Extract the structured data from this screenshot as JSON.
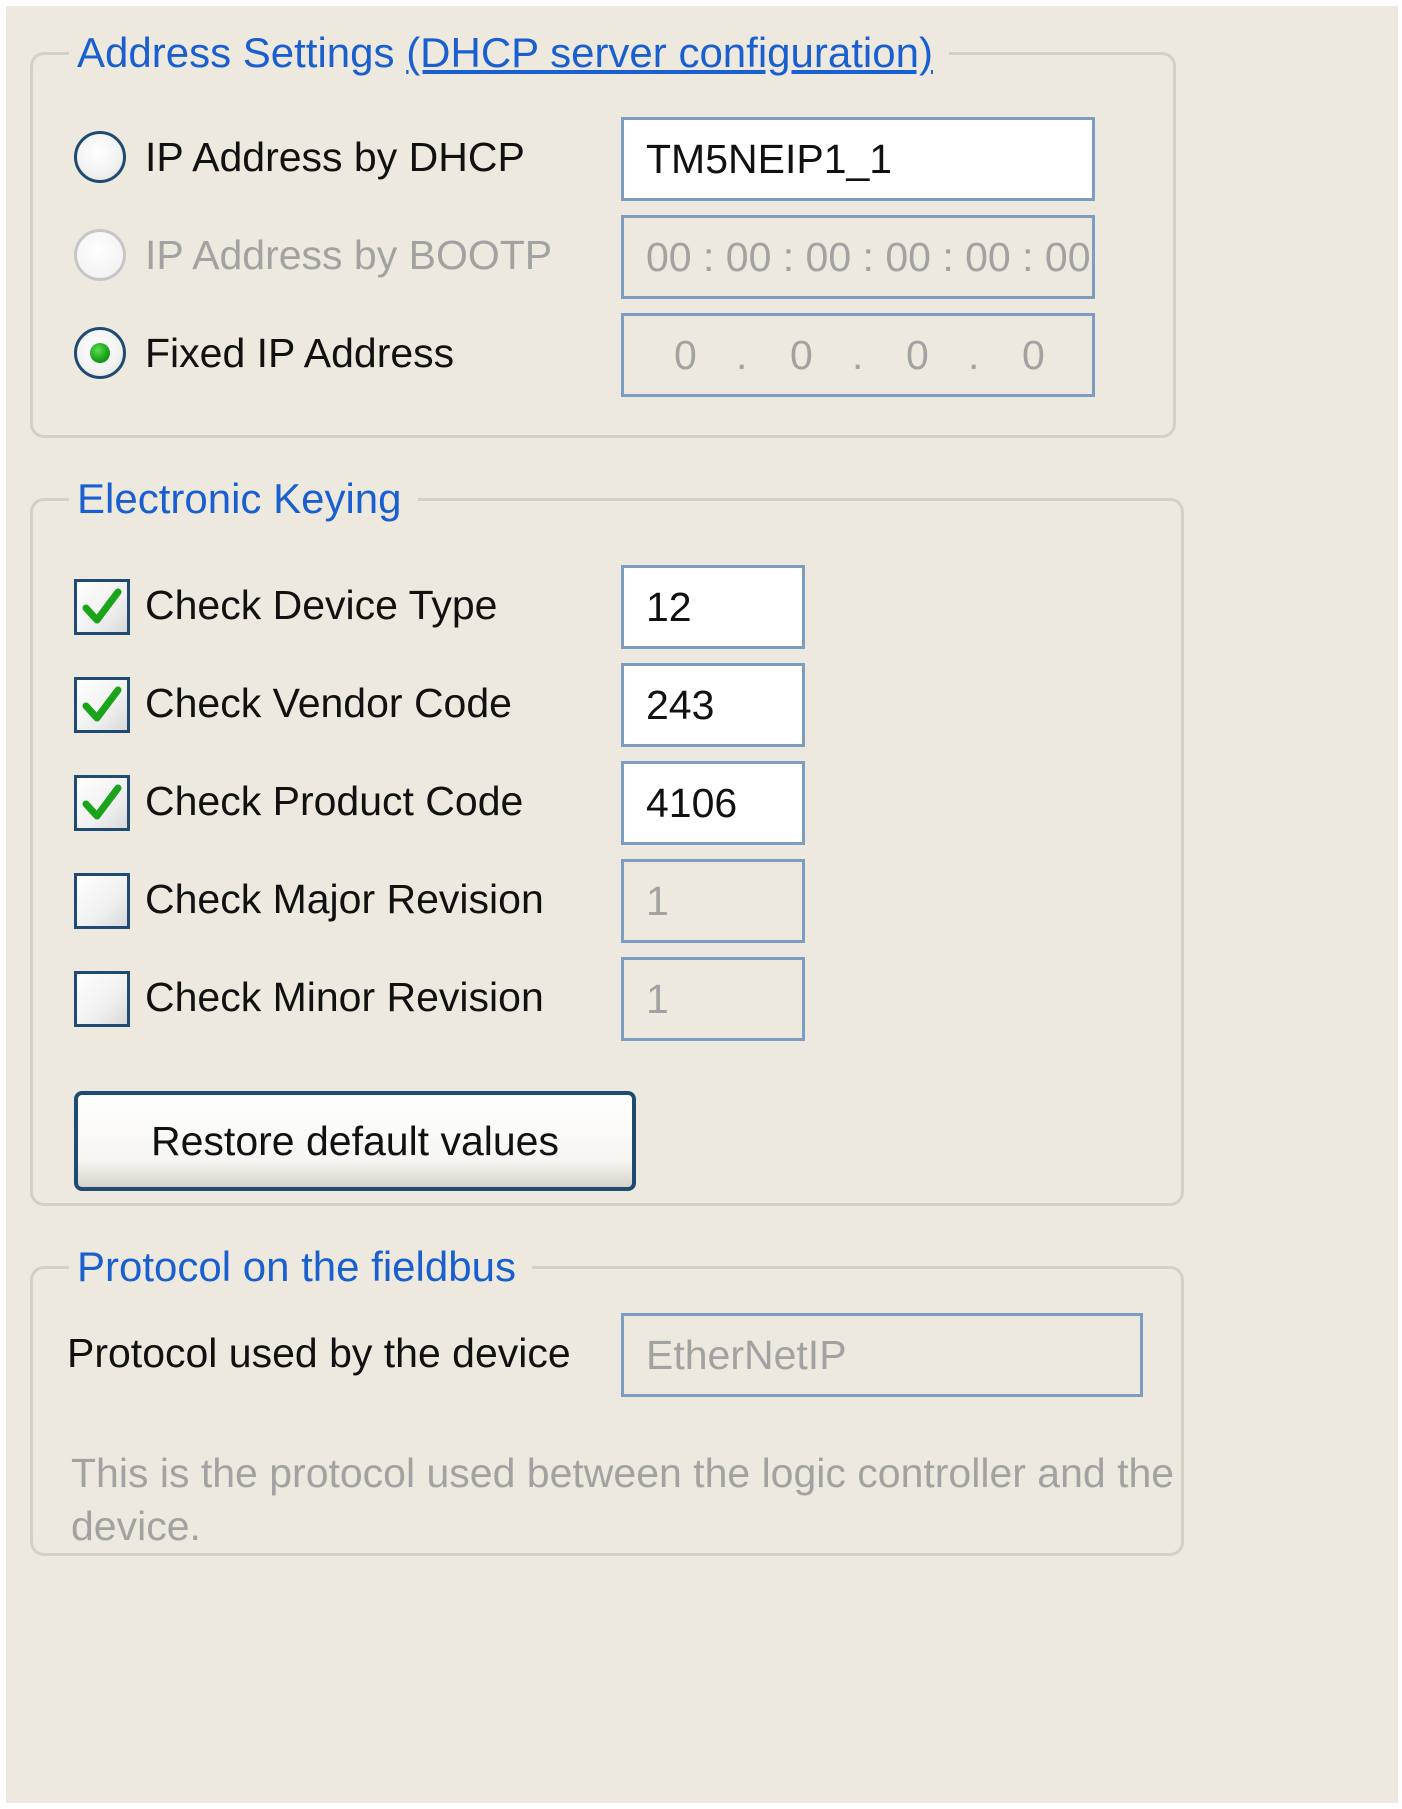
{
  "address_settings": {
    "legend": "Address Settings",
    "link": "(DHCP server configuration)",
    "dhcp": {
      "label": "IP Address by DHCP",
      "value": "TM5NEIP1_1",
      "selected": false
    },
    "bootp": {
      "label": "IP Address by BOOTP",
      "value": "00 : 00 : 00 : 00 : 00 : 00",
      "selected": false
    },
    "fixed": {
      "label": "Fixed IP Address",
      "octets": [
        "0",
        "0",
        "0",
        "0"
      ],
      "selected": true
    }
  },
  "electronic_keying": {
    "legend": "Electronic Keying",
    "items": [
      {
        "label": "Check Device Type",
        "value": "12",
        "checked": true
      },
      {
        "label": "Check Vendor Code",
        "value": "243",
        "checked": true
      },
      {
        "label": "Check Product Code",
        "value": "4106",
        "checked": true
      },
      {
        "label": "Check Major Revision",
        "value": "1",
        "checked": false
      },
      {
        "label": "Check Minor Revision",
        "value": "1",
        "checked": false
      }
    ],
    "restore_button": "Restore default values"
  },
  "protocol": {
    "legend": "Protocol on the fieldbus",
    "label": "Protocol used by the device",
    "value": "EtherNetIP",
    "description": "This is the protocol used between the logic controller and the device."
  },
  "colors": {
    "legend": "#1a5fd0",
    "field_border": "#7d9ec2",
    "control_border": "#1f4a72",
    "check_green": "#1aa41a",
    "panel_bg": "#ede9df"
  }
}
